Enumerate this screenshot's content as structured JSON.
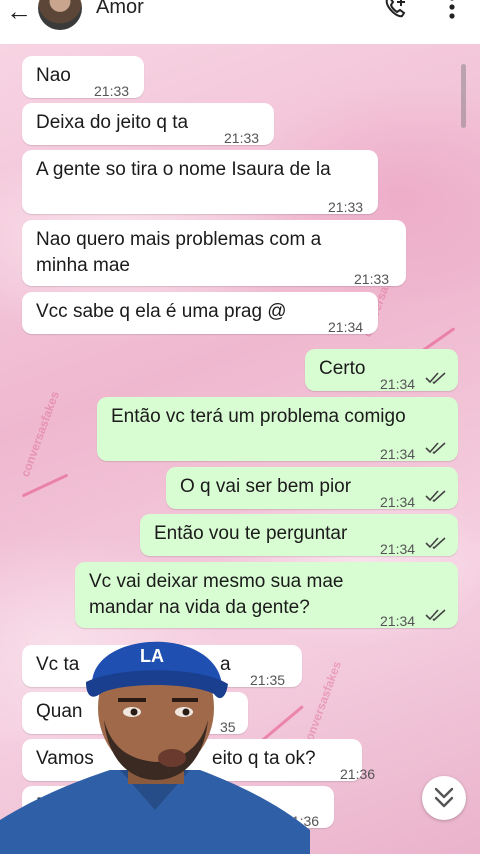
{
  "header": {
    "title": "Amor"
  },
  "icons": {
    "back": "back-arrow-icon",
    "call": "add-call-icon",
    "menu": "more-vert-icon",
    "scroll": "chevron-double-down-icon"
  },
  "colors": {
    "incoming": "#ffffff",
    "outgoing": "#d9fdd3",
    "wallpaper": "#f3c9dc",
    "ticks": "#53bdeb"
  },
  "messages": [
    {
      "dir": "in",
      "text": "Nao",
      "time": "21:33"
    },
    {
      "dir": "in",
      "text": "Deixa do jeito q ta",
      "time": "21:33"
    },
    {
      "dir": "in",
      "text": "A gente so tira o nome Isaura de la",
      "time": "21:33"
    },
    {
      "dir": "in",
      "text": "Nao quero mais problemas com a\nminha mae",
      "time": "21:33"
    },
    {
      "dir": "in",
      "text": "Vcc sabe q ela é uma prag @",
      "time": "21:34"
    },
    {
      "dir": "out",
      "text": "Certo",
      "time": "21:34"
    },
    {
      "dir": "out",
      "text": "Então vc terá um problema comigo",
      "time": "21:34"
    },
    {
      "dir": "out",
      "text": "O q vai ser bem pior",
      "time": "21:34"
    },
    {
      "dir": "out",
      "text": "Então vou te perguntar",
      "time": "21:34"
    },
    {
      "dir": "out",
      "text": "Vc vai deixar mesmo sua mae\nmandar na vida da gente?",
      "time": "21:34"
    },
    {
      "dir": "in",
      "text": "Vc ta",
      "text2": "a",
      "time": "21:35"
    },
    {
      "dir": "in",
      "text": "Quan",
      "time": "35"
    },
    {
      "dir": "in",
      "text": "Vamos",
      "text2": "eito q ta ok?",
      "time": "21:36"
    },
    {
      "dir": "in",
      "text": "E",
      "text2": "co",
      "time": "21:36"
    }
  ],
  "watermark": "conversasfakes",
  "overlay": {
    "cap_logo": "LA"
  }
}
